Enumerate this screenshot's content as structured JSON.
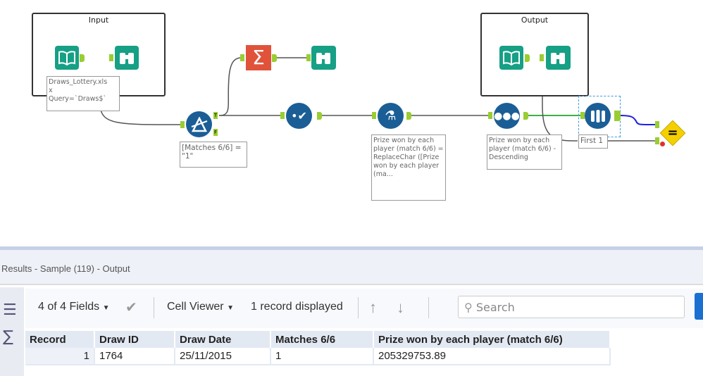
{
  "canvas": {
    "containers": [
      {
        "title": "Input"
      },
      {
        "title": "Output"
      }
    ],
    "annotations": {
      "input": "Draws_Lottery.xls\nx\nQuery=`Draws$`",
      "filter": "[Matches 6/6] =\n\"1\"",
      "formula": "Prize won by each player (match 6/6) = ReplaceChar ([Prize won by each player (ma...",
      "sort": "Prize won by each player (match 6/6) - Descending",
      "sample": "First 1"
    },
    "filter_true": "T",
    "filter_false": "F",
    "colors": {
      "input_tool": "#16a085",
      "summarize_tool": "#e0533a",
      "blue_tool": "#1b5e96",
      "test_tool": "#f5d000",
      "anchor": "#9acd32"
    }
  },
  "results": {
    "title": "Results - Sample (119) - Output",
    "fields_label": "4 of 4 Fields",
    "cell_viewer": "Cell Viewer",
    "records_displayed": "1 record displayed",
    "search_placeholder": "Search",
    "columns": [
      "Record",
      "Draw ID",
      "Draw Date",
      "Matches 6/6",
      "Prize won by each player (match 6/6)"
    ],
    "rows": [
      [
        "1",
        "1764",
        "25/11/2015",
        "1",
        "205329753.89"
      ]
    ]
  }
}
